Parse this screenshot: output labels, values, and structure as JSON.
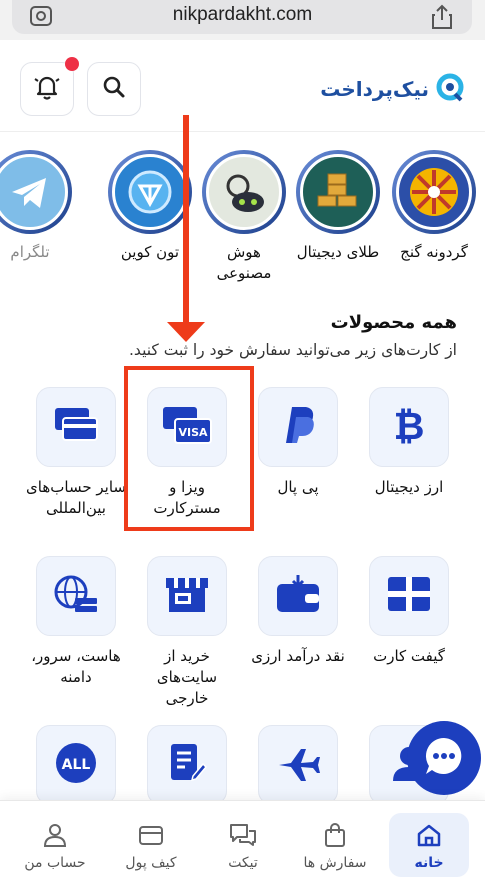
{
  "browser": {
    "url": "nikpardakht.com"
  },
  "header": {
    "logo_text": "نیک‌پرداخت"
  },
  "stories": [
    {
      "label": "گردونه گنج",
      "icon": "wheel-icon"
    },
    {
      "label": "طلای دیجیتال",
      "icon": "gold-bars-icon"
    },
    {
      "label": "هوش مصنوعی",
      "icon": "ai-robot-icon"
    },
    {
      "label": "تون کوین",
      "icon": "toncoin-icon"
    },
    {
      "label": "تلگرام",
      "icon": "telegram-icon"
    }
  ],
  "products": {
    "title": "همه محصولات",
    "subtitle": "از کارت‌های زیر می‌توانید سفارش خود را ثبت کنید.",
    "items": [
      {
        "label": "ارز دیجیتال",
        "icon": "bitcoin-icon"
      },
      {
        "label": "پی پال",
        "icon": "paypal-icon"
      },
      {
        "label": "ویزا و مسترکارت",
        "icon": "visa-card-icon"
      },
      {
        "label": "سایر حساب‌های بین‌المللی",
        "icon": "cards-icon"
      },
      {
        "label": "گیفت کارت",
        "icon": "gift-card-icon"
      },
      {
        "label": "نقد درآمد ارزی",
        "icon": "wallet-icon"
      },
      {
        "label": "خرید از سایت‌های خارجی",
        "icon": "store-icon"
      },
      {
        "label": "هاست، سرور، دامنه",
        "icon": "globe-server-icon"
      },
      {
        "label": "",
        "icon": "user-icon"
      },
      {
        "label": "",
        "icon": "airplane-icon"
      },
      {
        "label": "",
        "icon": "document-icon"
      },
      {
        "label": "ALL",
        "icon": "all-icon"
      }
    ]
  },
  "bottom_nav": [
    {
      "label": "خانه",
      "icon": "home-icon",
      "active": true
    },
    {
      "label": "سفارش ها",
      "icon": "bag-icon",
      "active": false
    },
    {
      "label": "تیکت",
      "icon": "chat-bubbles-icon",
      "active": false
    },
    {
      "label": "کیف پول",
      "icon": "wallet-icon",
      "active": false
    },
    {
      "label": "حساب من",
      "icon": "user-icon",
      "active": false
    }
  ],
  "colors": {
    "primary": "#1d3fbe",
    "accent_red": "#ee3b1a",
    "tile_bg": "#eff4fd"
  }
}
